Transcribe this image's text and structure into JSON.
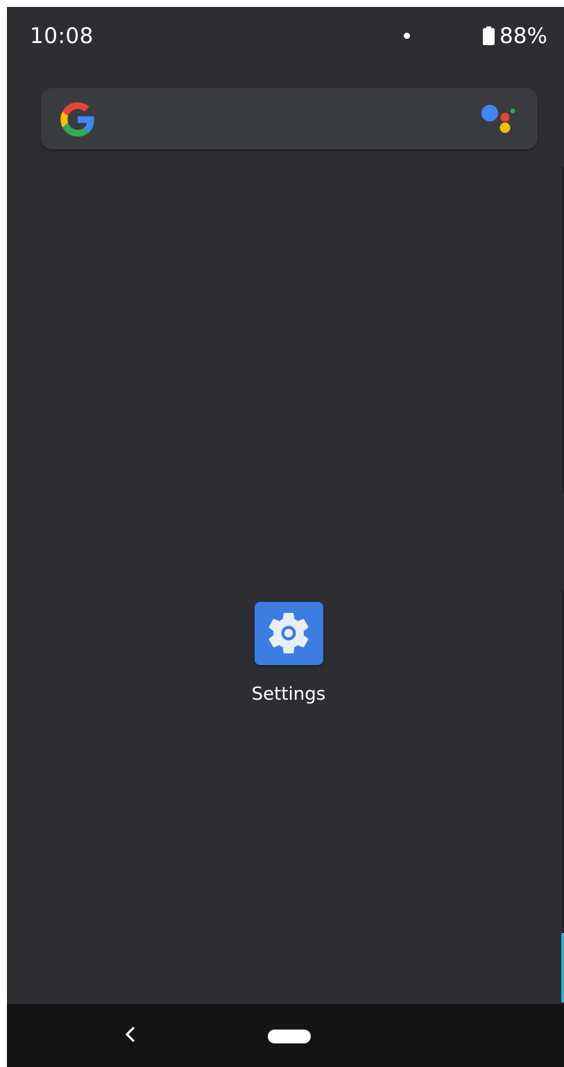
{
  "status_bar": {
    "time": "10:08",
    "battery_level": "88%",
    "battery_icon": "battery-icon",
    "notification_indicator": "dot"
  },
  "search_widget": {
    "logo_icon": "google-g-icon",
    "assistant_icon": "google-assistant-icon"
  },
  "apps": [
    {
      "label": "Settings",
      "icon": "gear-icon",
      "color": "#3b7de0"
    }
  ],
  "navigation": {
    "back_icon": "back-chevron-icon",
    "home_icon": "home-pill-icon"
  },
  "colors": {
    "background": "#2e2e32",
    "search_bar": "#3a3b3f",
    "nav_bar": "#141414",
    "accent_edge": "#2ab2c9"
  }
}
